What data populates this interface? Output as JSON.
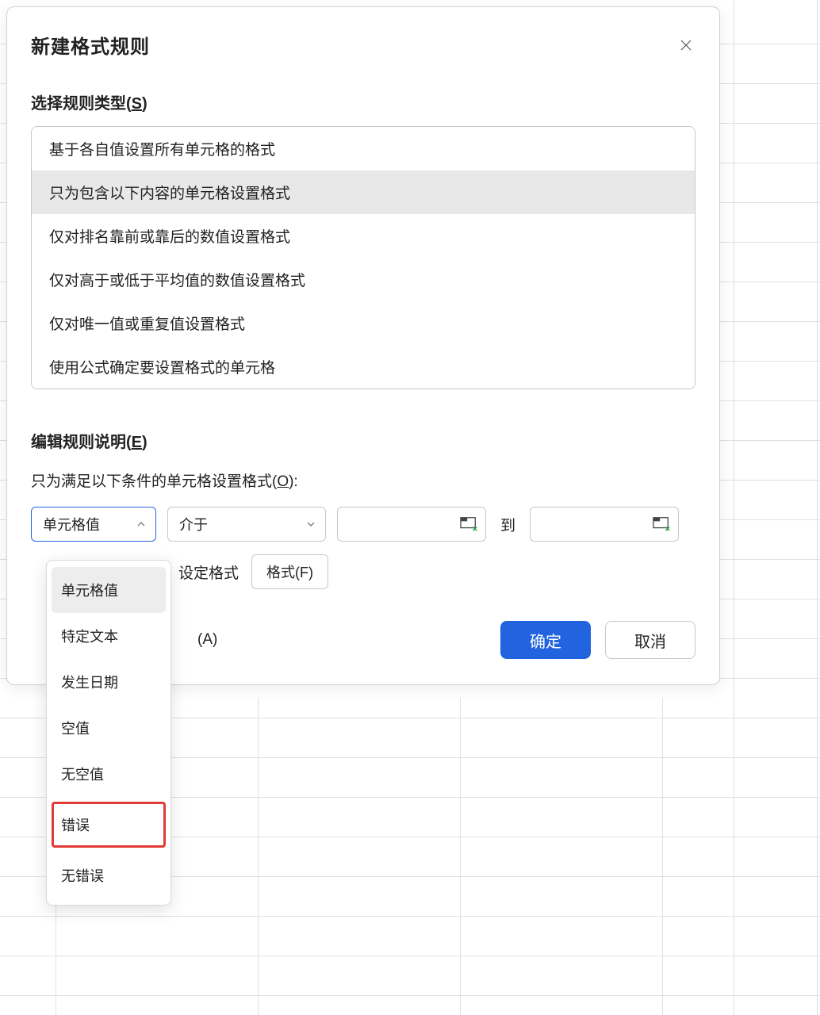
{
  "dialog": {
    "title": "新建格式规则",
    "rule_type_section": {
      "label_prefix": "选择规则类型(",
      "label_key": "S",
      "label_suffix": ")",
      "items": [
        "基于各自值设置所有单元格的格式",
        "只为包含以下内容的单元格设置格式",
        "仅对排名靠前或靠后的数值设置格式",
        "仅对高于或低于平均值的数值设置格式",
        "仅对唯一值或重复值设置格式",
        "使用公式确定要设置格式的单元格"
      ],
      "selected_index": 1
    },
    "edit_section": {
      "label_prefix": "编辑规则说明(",
      "label_key": "E",
      "label_suffix": ")",
      "cond_label_prefix": "只为满足以下条件的单元格设置格式(",
      "cond_label_key": "O",
      "cond_label_suffix": "):",
      "dropdown1_value": "单元格值",
      "dropdown2_value": "介于",
      "to_label": "到",
      "set_format_label": "设定格式",
      "format_button": "格式(F)"
    },
    "footer": {
      "apply_suffix": "(A)",
      "ok": "确定",
      "cancel": "取消"
    },
    "dropdown_menu": {
      "options": [
        "单元格值",
        "特定文本",
        "发生日期",
        "空值",
        "无空值",
        "错误",
        "无错误"
      ],
      "active_index": 0,
      "highlighted_index": 5
    }
  }
}
